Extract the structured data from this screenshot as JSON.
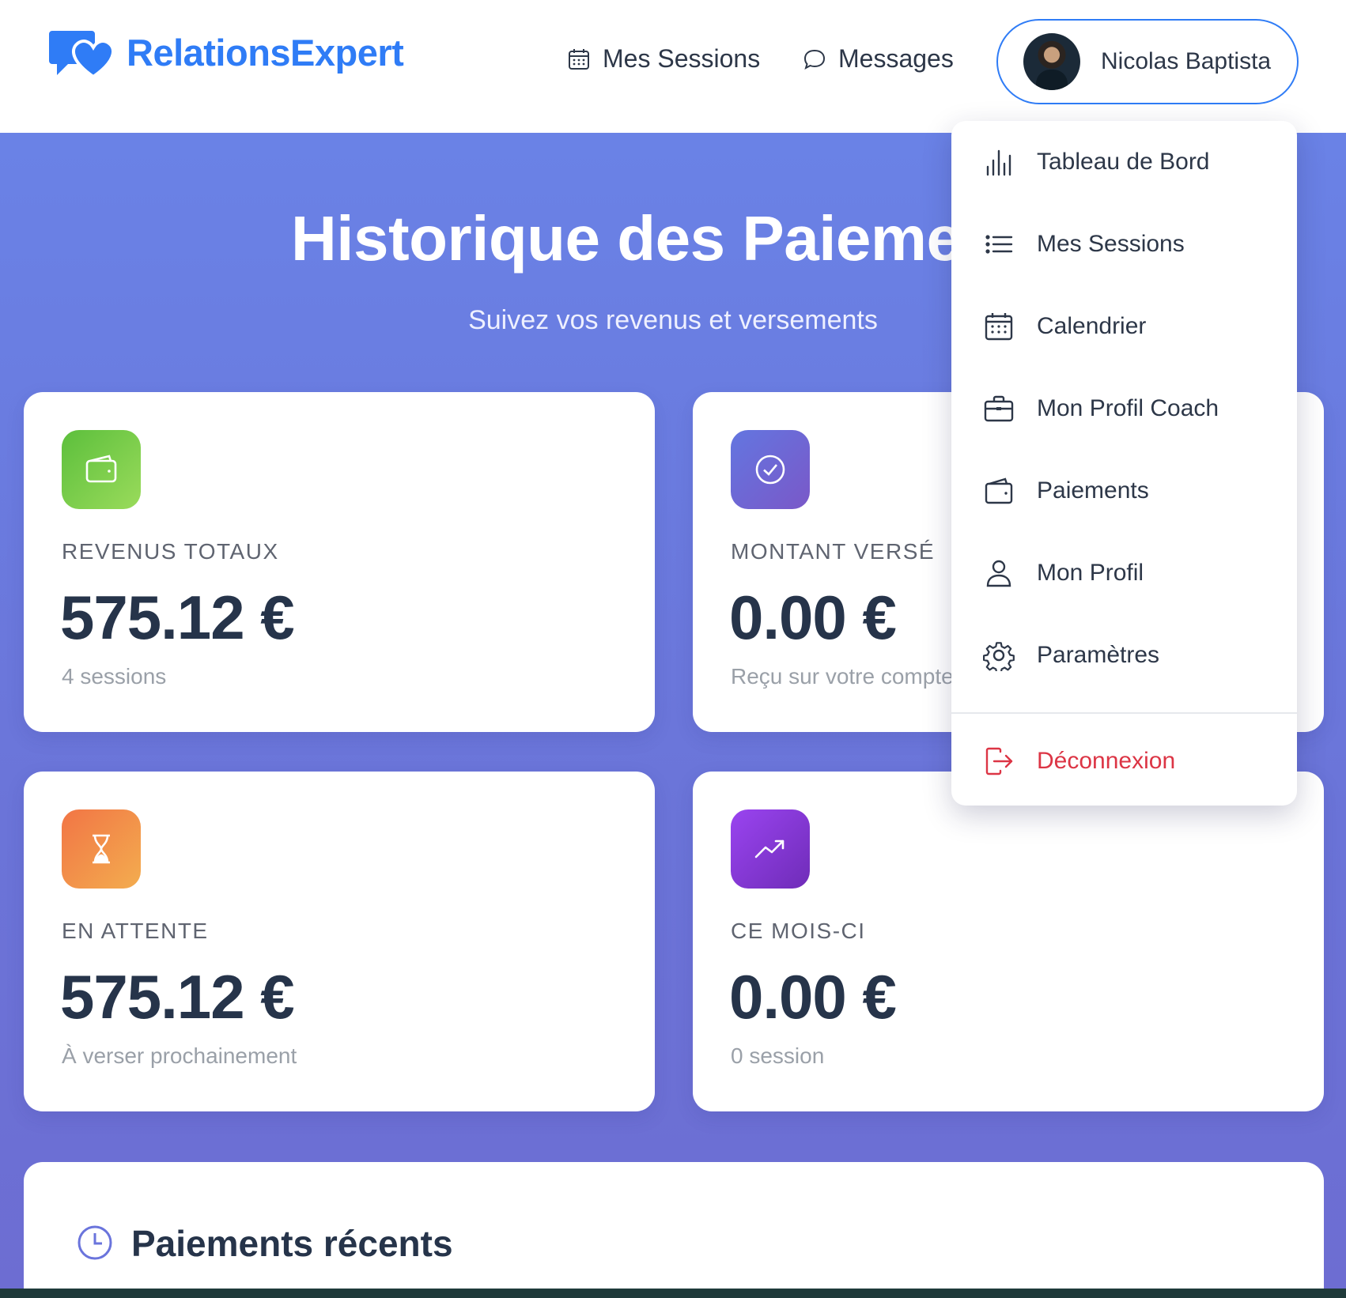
{
  "brand": {
    "name": "RelationsExpert",
    "color": "#2f7cf6"
  },
  "nav": {
    "sessions": {
      "label": "Mes Sessions",
      "icon": "calendar-icon"
    },
    "messages": {
      "label": "Messages",
      "icon": "chat-bubble-icon"
    }
  },
  "user": {
    "name": "Nicolas Baptista"
  },
  "hero": {
    "title": "Historique des Paiements",
    "subtitle": "Suivez vos revenus et versements"
  },
  "stats": [
    {
      "label": "REVENUS TOTAUX",
      "value": "575.12 €",
      "sub": "4 sessions",
      "icon": "wallet-icon",
      "color": "#5cbf3c"
    },
    {
      "label": "MONTANT VERSÉ",
      "value": "0.00 €",
      "sub": "Reçu sur votre compte",
      "icon": "check-circle-icon",
      "color": "#6376e0"
    },
    {
      "label": "EN ATTENTE",
      "value": "575.12 €",
      "sub": "À verser prochainement",
      "icon": "hourglass-icon",
      "color": "#f27545"
    },
    {
      "label": "CE MOIS-CI",
      "value": "0.00 €",
      "sub": "0 session",
      "icon": "trending-up-icon",
      "color": "#9a44f0"
    }
  ],
  "recent": {
    "title": "Paiements récents",
    "icon": "clock-icon"
  },
  "menu": {
    "items": [
      {
        "label": "Tableau de Bord",
        "icon": "bar-chart-icon"
      },
      {
        "label": "Mes Sessions",
        "icon": "list-icon"
      },
      {
        "label": "Calendrier",
        "icon": "calendar-icon"
      },
      {
        "label": "Mon Profil Coach",
        "icon": "briefcase-icon"
      },
      {
        "label": "Paiements",
        "icon": "wallet-icon"
      },
      {
        "label": "Mon Profil",
        "icon": "person-icon"
      },
      {
        "label": "Paramètres",
        "icon": "gear-icon"
      }
    ],
    "logout": {
      "label": "Déconnexion",
      "icon": "logout-icon",
      "color": "#dc3545"
    }
  }
}
